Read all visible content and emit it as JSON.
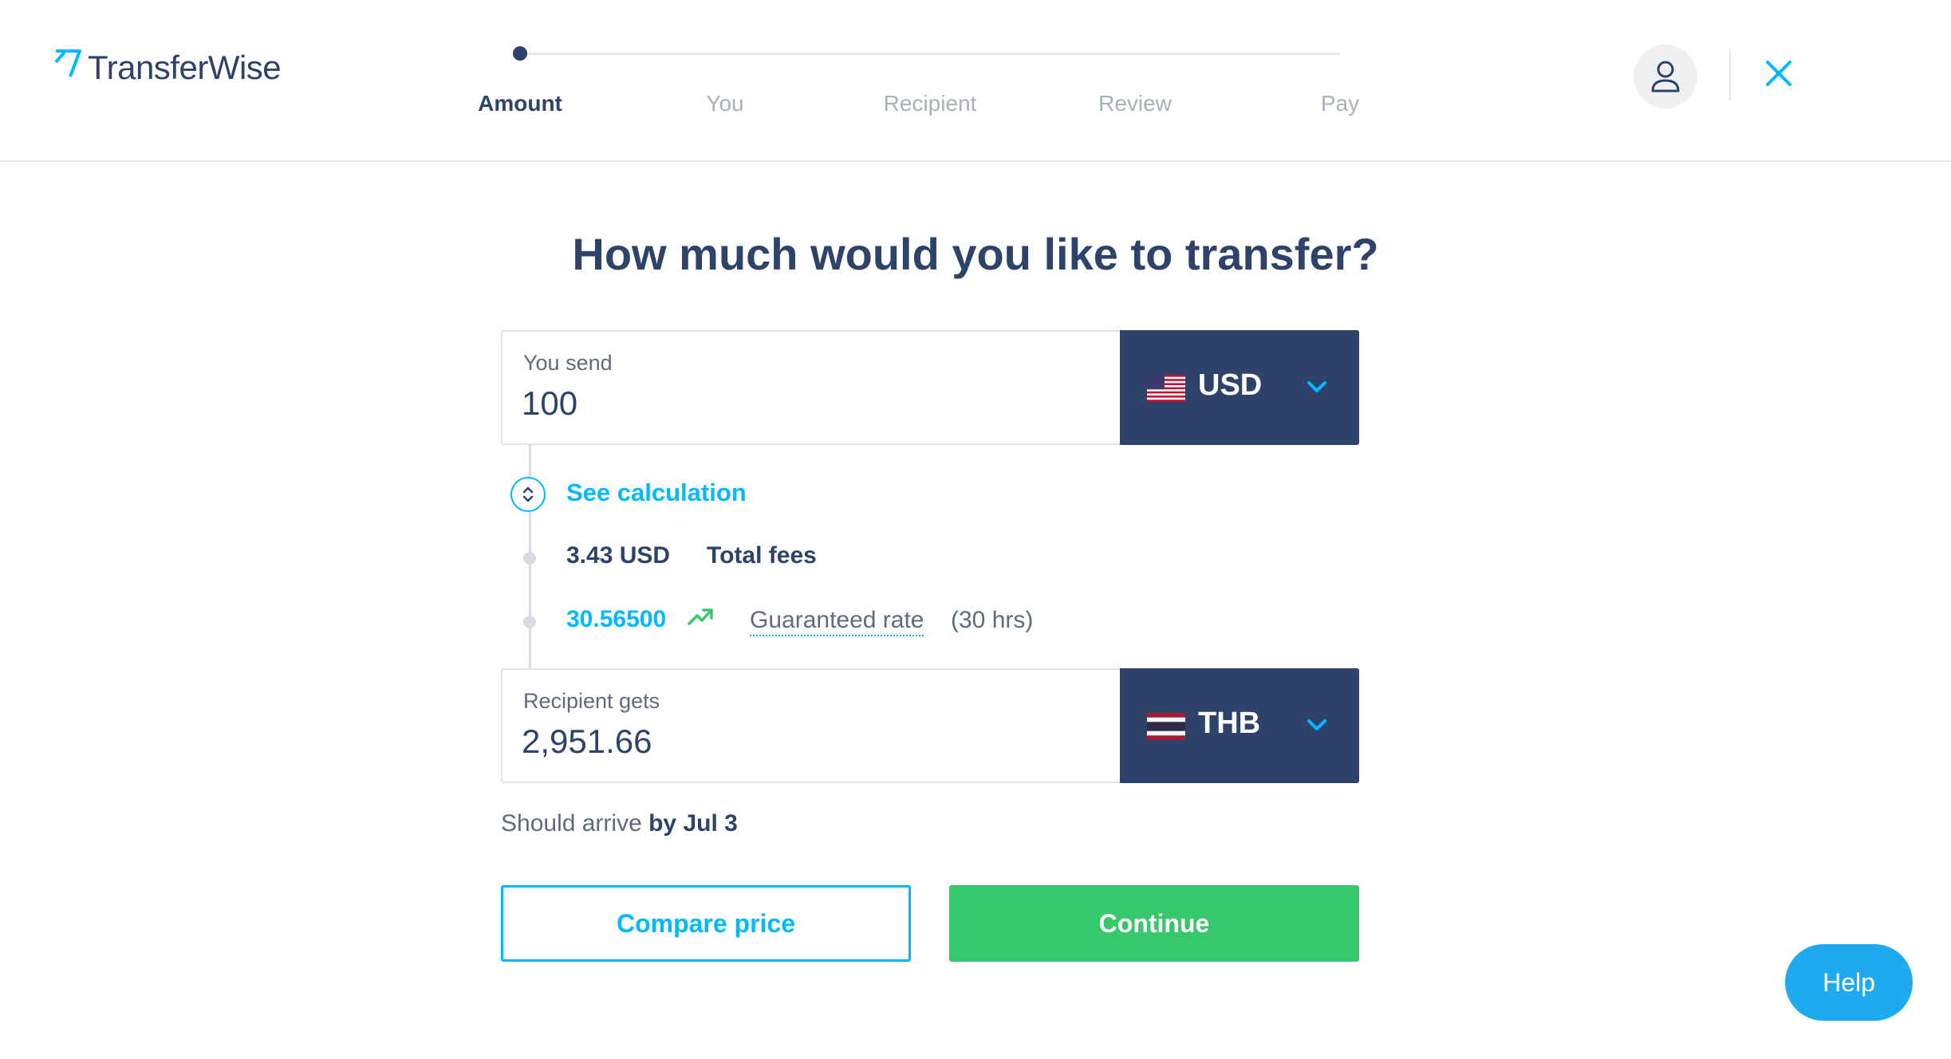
{
  "header": {
    "logo_text": "TransferWise",
    "steps": [
      "Amount",
      "You",
      "Recipient",
      "Review",
      "Pay"
    ],
    "active_step": "Amount"
  },
  "main": {
    "title": "How much would you like to transfer?",
    "send": {
      "label": "You send",
      "value": "100",
      "currency": "USD",
      "flag_icon": "us-flag-icon"
    },
    "calculation": {
      "toggle_label": "See calculation",
      "fee_amount": "3.43 USD",
      "fee_label": "Total fees",
      "rate_value": "30.56500",
      "rate_label": "Guaranteed rate",
      "rate_duration": "(30 hrs)"
    },
    "receive": {
      "label": "Recipient gets",
      "value": "2,951.66",
      "currency": "THB",
      "flag_icon": "thailand-flag-icon"
    },
    "arrival": {
      "prefix": "Should arrive",
      "date": "by Jul 3"
    },
    "buttons": {
      "compare": "Compare price",
      "continue": "Continue"
    }
  },
  "help_label": "Help",
  "colors": {
    "navy": "#2e4369",
    "accent_blue": "#00b9ff",
    "green": "#37c86b",
    "help_blue": "#1eaaf1"
  }
}
